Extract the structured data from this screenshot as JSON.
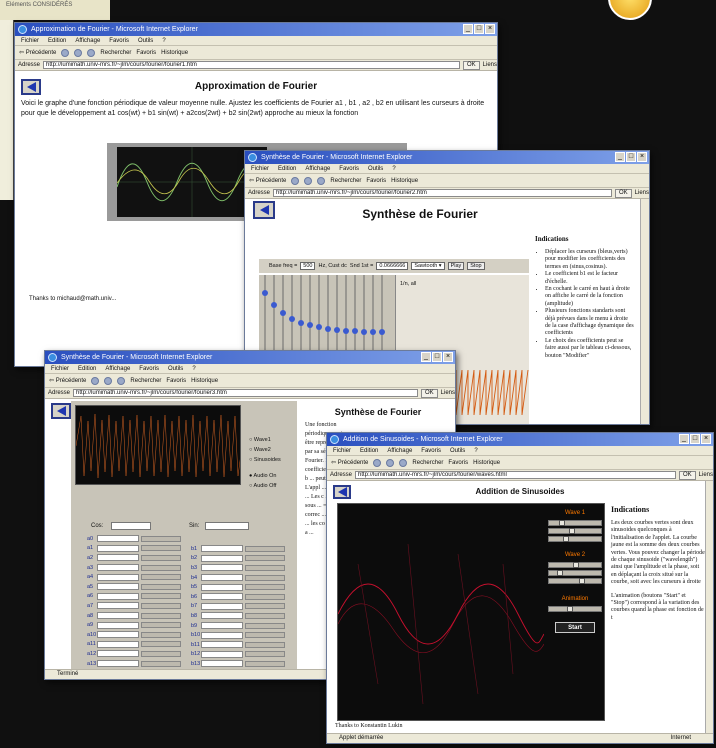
{
  "corner_text": "Eléments CONSIDÉRÉS",
  "colors": {
    "title_bar": "#2a4fbf",
    "scope_bg": "#0c0c0c",
    "trace_green": "#7fbf6a",
    "trace_orange": "#ff7a00",
    "trace_red": "#c8102e"
  },
  "menu": [
    "Fichier",
    "Edition",
    "Affichage",
    "Favoris",
    "Outils",
    "?"
  ],
  "toolbar": {
    "back": "Précédente",
    "search": "Rechercher",
    "favorites": "Favoris",
    "history": "Historique"
  },
  "address_label": "Adresse",
  "go_label": "OK",
  "links_label": "Liens",
  "win1": {
    "title": "Approximation de Fourier - Microsoft Internet Explorer",
    "address": "http://lumimath.univ-mrs.fr/~jlm/cours/fourier/fourier1.htm",
    "heading": "Approximation de Fourier",
    "intro": "Voici le graphe d'une fonction périodique de valeur moyenne nulle. Ajustez les coefficients de Fourier a1 , b1 , a2 , b2 en utilisant les curseurs à droite pour que le développement a1 cos(wt) + b1 sin(wt) + a2cos(2wt) + b2 sin(2wt) approche au mieux la fonction",
    "thanks": "Thanks to michaud@math.univ..."
  },
  "win2": {
    "title": "Synthèse de Fourier - Microsoft Internet Explorer",
    "address": "http://lumimath.univ-mrs.fr/~jlm/cours/fourier/fourier2.htm",
    "heading": "Synthèse de Fourier",
    "ctrl_freq_label": "Base freq =",
    "ctrl_freq_value": "500",
    "ctrl_hz": "Hz, Cust dc",
    "ctrl_snd": "Snd 1st =",
    "ctrl_snd_value": "0.0666666",
    "ctrl_wave": "Sawtooth",
    "play": "Play",
    "stop": "Stop",
    "scope_label": "1/n, all",
    "indications_title": "Indications",
    "indications": [
      "Déplacer les curseurs (bleus,verts) pour modifier les coefficients des termes en (sinus,cosinus).",
      "Le coefficient b1 est le facteur d'échelle.",
      "En cochant le carré en haut à droite on affiche le carré de la fonction (amplitude)",
      "Plusieurs fonctions standarts sont déjà prévues dans le menu à droite de la case d'affichage dynamique des coefficients",
      "Le choix des coefficients peut se faire aussi par le tableau ci-dessous, bouton \"Modifier\""
    ]
  },
  "win3": {
    "title": "Synthèse de Fourier - Microsoft Internet Explorer",
    "address": "http://lumimath.univ-mrs.fr/~jlm/cours/fourier/fourier3.htm",
    "heading": "Synthèse de Fourier",
    "radios": [
      "Wave1",
      "Wave2",
      "Sinusoides"
    ],
    "audio": [
      "Audio On",
      "Audio Off"
    ],
    "cos_label": "Cos:",
    "sin_label": "Sin:",
    "a_rows": [
      "a0",
      "a1",
      "a2",
      "a3",
      "a4",
      "a5",
      "a6",
      "a7",
      "a8",
      "a9",
      "a10",
      "a11",
      "a12",
      "a13"
    ],
    "b_rows": [
      "b1",
      "b2",
      "b3",
      "b4",
      "b5",
      "b6",
      "b7",
      "b8",
      "b9",
      "b10",
      "b11",
      "b12",
      "b13"
    ],
    "text": "Une fonction périodique peut être représentée par sa série de Fourier. Les coefficients a et b ... peut ... L'appl ... à de ... Les c ... = sous ... = par ... correc ... les co ... les co ... noté a ...",
    "status": "Terminé"
  },
  "win4": {
    "title": "Addition de Sinusoides - Microsoft Internet Explorer",
    "address": "http://lumimath.univ-mrs.fr/~jlm/cours/fourier/waves.html",
    "heading": "Addition de Sinusoides",
    "indications_title": "Indications",
    "para1": "Les deux courbes vertes sont deux sinusoides quelconques à l'initialisation de l'applet. La courbe jaune est la somme des deux courbes vertes. Vous pouvez changer la période de chaque sinusoide (\"wavelength\") ainsi que l'amplitude et la phase, soit en déplaçant la croix situé sur la courbe, soit avec les curseurs à droite",
    "para2": "L'animation (boutons \"Start\" et \"Stop\") correspond à la variation des courbes quand la phase est fonction de t",
    "panel_labels": [
      "Wave 1",
      "Wave 2",
      "Animation"
    ],
    "start": "Start",
    "thanks": "Thanks to Konstantin Lukin",
    "status": "Applet démarrée",
    "zone": "Internet"
  }
}
